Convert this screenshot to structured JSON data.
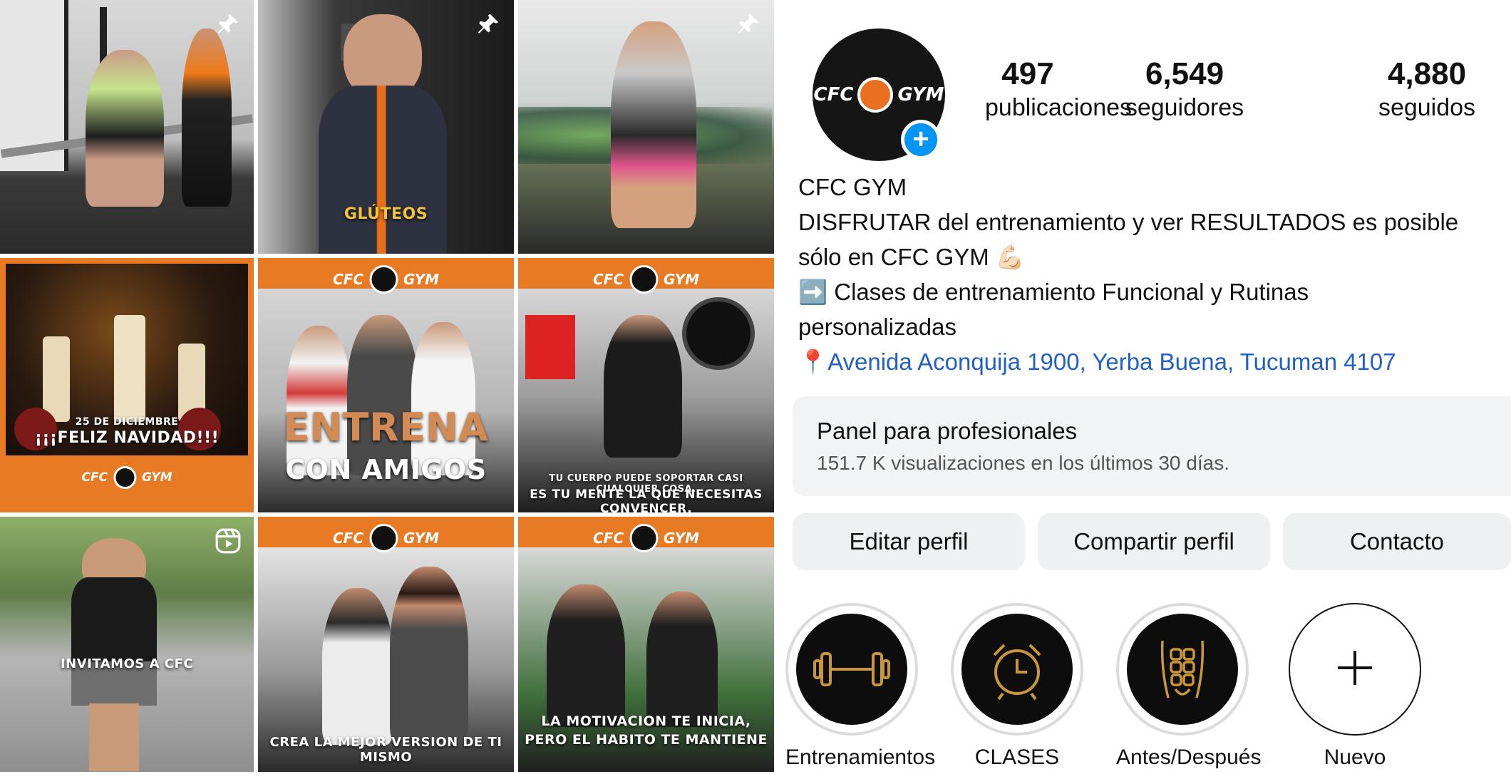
{
  "grid": {
    "tiles": [
      {
        "id": "t1",
        "caption": "",
        "pinned": true
      },
      {
        "id": "t2",
        "caption": "GLÚTEOS",
        "pinned": true
      },
      {
        "id": "t3",
        "caption": "",
        "pinned": true
      },
      {
        "id": "t4",
        "caption_top": "25 DE DICIEMBRE",
        "caption": "¡¡¡FELIZ NAVIDAD!!!",
        "logo": "CFC GYM"
      },
      {
        "id": "t5",
        "caption_line1": "ENTRENA",
        "caption_line2": "CON AMIGOS",
        "logo": "CFC GYM"
      },
      {
        "id": "t6",
        "caption_line1": "TU CUERPO PUEDE SOPORTAR CASI CUALQUIER COSA.",
        "caption_line2": "ES TU MENTE LA QUE NECESITAS CONVENCER.",
        "logo": "CFC GYM"
      },
      {
        "id": "t7",
        "caption": "INVITAMOS A CFC",
        "reel": true
      },
      {
        "id": "t8",
        "caption": "CREA LA MEJOR VERSION DE TI MISMO",
        "logo": "CFC GYM"
      },
      {
        "id": "t9",
        "caption_line1": "LA MOTIVACION TE INICIA,",
        "caption_line2": "PERO EL HABITO TE MANTIENE",
        "logo": "CFC GYM"
      }
    ]
  },
  "profile": {
    "avatar_logo_left": "CFC",
    "avatar_logo_right": "GYM",
    "stats": [
      {
        "value": "497",
        "label": "publicaciones"
      },
      {
        "value": "6,549",
        "label": "seguidores"
      },
      {
        "value": "4,880",
        "label": "seguidos"
      }
    ],
    "name": "CFC GYM",
    "bio_line1": "DISFRUTAR del entrenamiento y ver RESULTADOS es posible",
    "bio_line2": "sólo en CFC GYM 💪🏻",
    "bio_line3": "➡️ Clases de entrenamiento Funcional y Rutinas",
    "bio_line4": "personalizadas",
    "location_pin": "📍",
    "location": "Avenida Aconquija 1900, Yerba Buena, Tucuman 4107",
    "panel_title": "Panel para profesionales",
    "panel_subtitle": "151.7 K visualizaciones en los últimos 30 días.",
    "buttons": {
      "edit": "Editar perfil",
      "share": "Compartir perfil",
      "contact": "Contacto"
    },
    "highlights": [
      {
        "label": "Entrenamientos",
        "icon": "dumbbell-icon"
      },
      {
        "label": "CLASES",
        "icon": "alarm-clock-icon"
      },
      {
        "label": "Antes/Después",
        "icon": "abs-icon"
      },
      {
        "label": "Nuevo",
        "icon": "plus-icon"
      }
    ]
  },
  "colors": {
    "accent": "#0095f6",
    "orange": "#e8701f",
    "link": "#2161c6",
    "gold": "#c9973a"
  }
}
